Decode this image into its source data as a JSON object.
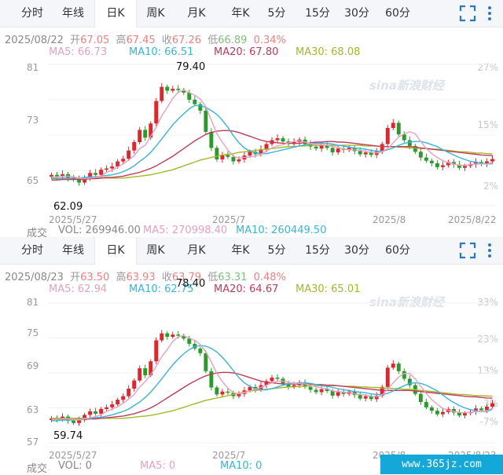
{
  "tabs": [
    "分时",
    "年线",
    "日K",
    "周K",
    "月K",
    "年K",
    "5分",
    "15分",
    "30分",
    "60分"
  ],
  "active_tab": "日K",
  "colors": {
    "up": "#e3242b",
    "down": "#2a9b2a",
    "ma5": "#e8a0bf",
    "ma10": "#35b5e0",
    "ma20": "#c43a5a",
    "ma30": "#a4b828"
  },
  "charts": [
    {
      "header": {
        "date": "2025/08/22",
        "open_label": "开",
        "open": "67.05",
        "high_label": "高",
        "high": "67.45",
        "close_label": "收",
        "close": "67.26",
        "low_label": "低",
        "low": "66.89",
        "change_pct": "0.34%"
      },
      "ma_labels": {
        "ma5": "MA5: 66.73",
        "ma10": "MA10: 66.51",
        "ma20": "MA20: 67.80",
        "ma30": "MA30: 68.08"
      },
      "y_ticks": [
        "81",
        "73",
        "65"
      ],
      "y_pct_ticks": [
        "27%",
        "15%",
        "2%"
      ],
      "x_ticks": [
        "2025/5/27",
        "2025/7",
        "2025/8",
        "2025/8/22"
      ],
      "annotations": {
        "max": "79.40",
        "min": "62.09"
      },
      "volume": {
        "label": "成交",
        "vol": "VOL: 269946.00",
        "ma5": "MA5: 270998.40",
        "ma10": "MA10: 260449.50"
      },
      "watermark": "sina新浪财经"
    },
    {
      "header": {
        "date": "2025/08/23",
        "open_label": "开",
        "open": "63.50",
        "high_label": "高",
        "high": "63.93",
        "close_label": "收",
        "close": "63.79",
        "low_label": "低",
        "low": "63.31",
        "change_pct": "0.48%"
      },
      "ma_labels": {
        "ma5": "MA5: 62.94",
        "ma10": "MA10: 62.75",
        "ma20": "MA20: 64.67",
        "ma30": "MA30: 65.01"
      },
      "y_ticks": [
        "81",
        "75",
        "69",
        "63",
        "57"
      ],
      "y_pct_ticks": [
        "33%",
        "23%",
        "13%",
        "3%",
        "-7%"
      ],
      "x_ticks": [
        "2025/5/27",
        "2025/7",
        "2025/8",
        "2025/8/23"
      ],
      "annotations": {
        "max": "78.40",
        "min": "59.74"
      },
      "volume": {
        "label": "成交",
        "vol": "VOL: 0",
        "ma5": "MA5: 0",
        "ma10": "MA10: 0"
      },
      "watermark": "sina新浪财经"
    }
  ],
  "chart_data": [
    {
      "type": "candlestick",
      "ylim": [
        60,
        82
      ],
      "close": [
        64.8,
        64.5,
        64.9,
        64.3,
        64.1,
        63.6,
        64.4,
        65.1,
        64.8,
        65.6,
        65.8,
        66.1,
        66.9,
        67.3,
        68.6,
        69.9,
        71.8,
        70.6,
        72.8,
        76.3,
        78.5,
        77.9,
        78.2,
        78.0,
        77.6,
        76.5,
        75.8,
        74.8,
        71.5,
        69.0,
        67.2,
        67.9,
        67.6,
        66.9,
        67.2,
        67.8,
        68.4,
        68.0,
        68.8,
        69.6,
        70.2,
        70.5,
        70.0,
        69.6,
        69.9,
        70.3,
        69.6,
        69.2,
        68.9,
        69.4,
        69.0,
        68.3,
        68.9,
        68.7,
        69.0,
        68.5,
        68.0,
        68.3,
        67.9,
        68.4,
        69.6,
        72.1,
        72.9,
        71.1,
        70.2,
        69.3,
        68.4,
        67.5,
        67.0,
        66.6,
        66.0,
        66.3,
        66.8,
        66.4,
        65.9,
        66.2,
        66.4,
        66.8,
        66.5,
        66.9,
        67.26
      ],
      "ma5": [
        64.5,
        64.5,
        64.6,
        64.6,
        64.5,
        64.3,
        64.2,
        64.3,
        64.4,
        64.6,
        65.2,
        65.5,
        66.0,
        66.5,
        67.1,
        67.8,
        68.9,
        69.4,
        70.8,
        72.2,
        74.0,
        75.3,
        76.7,
        77.7,
        78.0,
        77.6,
        77.2,
        76.6,
        75.4,
        73.3,
        71.2,
        69.9,
        68.7,
        67.7,
        67.4,
        67.5,
        67.6,
        67.7,
        68.0,
        68.5,
        69.0,
        69.3,
        69.5,
        69.8,
        70.0,
        70.1,
        69.9,
        69.7,
        69.5,
        69.5,
        69.4,
        69.2,
        69.1,
        68.8,
        68.7,
        68.7,
        68.6,
        68.5,
        68.3,
        68.2,
        68.4,
        68.9,
        69.8,
        70.7,
        71.2,
        71.5,
        71.2,
        70.0,
        68.9,
        68.1,
        67.5,
        67.0,
        66.7,
        66.5,
        66.3,
        66.3,
        66.4,
        66.5,
        66.5,
        66.5,
        66.73
      ],
      "ma10": [
        64.2,
        64.2,
        64.3,
        64.3,
        64.3,
        64.3,
        64.4,
        64.5,
        64.5,
        64.6,
        64.7,
        64.8,
        65.0,
        65.3,
        65.7,
        66.2,
        66.9,
        67.5,
        68.3,
        69.3,
        70.4,
        71.5,
        72.6,
        73.5,
        74.3,
        75.1,
        75.6,
        75.6,
        75.3,
        74.8,
        74.2,
        73.3,
        72.2,
        70.9,
        69.8,
        69.0,
        68.5,
        68.2,
        68.1,
        68.1,
        68.3,
        68.5,
        68.7,
        68.9,
        69.1,
        69.3,
        69.5,
        69.6,
        69.7,
        69.7,
        69.7,
        69.6,
        69.4,
        69.3,
        69.1,
        69.0,
        68.9,
        68.8,
        68.6,
        68.5,
        68.5,
        68.7,
        69.0,
        69.4,
        69.7,
        69.9,
        70.0,
        70.0,
        69.8,
        69.5,
        69.2,
        68.7,
        68.3,
        67.9,
        67.5,
        67.2,
        66.9,
        66.8,
        66.6,
        66.5,
        66.51
      ],
      "ma20": [
        64.0,
        64.0,
        64.1,
        64.1,
        64.1,
        64.1,
        64.1,
        64.2,
        64.2,
        64.3,
        64.4,
        64.4,
        64.5,
        64.6,
        64.8,
        65.0,
        65.2,
        65.5,
        65.8,
        66.2,
        66.7,
        67.2,
        67.7,
        68.3,
        68.9,
        69.5,
        70.1,
        70.6,
        71.1,
        71.4,
        71.6,
        71.7,
        71.7,
        71.6,
        71.4,
        71.1,
        70.8,
        70.5,
        70.2,
        70.0,
        69.9,
        69.8,
        69.7,
        69.7,
        69.7,
        69.7,
        69.8,
        69.8,
        69.9,
        69.9,
        70.0,
        70.0,
        69.9,
        69.9,
        69.8,
        69.7,
        69.6,
        69.5,
        69.4,
        69.3,
        69.2,
        69.2,
        69.2,
        69.2,
        69.2,
        69.2,
        69.1,
        69.0,
        68.9,
        68.8,
        68.7,
        68.6,
        68.5,
        68.4,
        68.3,
        68.2,
        68.1,
        68.0,
        67.9,
        67.85,
        67.8
      ],
      "ma30": [
        64.3,
        64.3,
        64.3,
        64.3,
        64.3,
        64.3,
        64.3,
        64.3,
        64.3,
        64.3,
        64.3,
        64.3,
        64.3,
        64.3,
        64.4,
        64.5,
        64.6,
        64.7,
        64.8,
        65.0,
        65.2,
        65.4,
        65.6,
        65.9,
        66.2,
        66.5,
        66.8,
        67.1,
        67.3,
        67.5,
        67.7,
        67.9,
        68.0,
        68.1,
        68.3,
        68.4,
        68.5,
        68.6,
        68.7,
        68.8,
        68.9,
        69.0,
        69.1,
        69.2,
        69.2,
        69.3,
        69.3,
        69.4,
        69.4,
        69.4,
        69.4,
        69.4,
        69.4,
        69.4,
        69.4,
        69.4,
        69.4,
        69.3,
        69.3,
        69.3,
        69.2,
        69.2,
        69.2,
        69.1,
        69.1,
        69.0,
        69.0,
        68.9,
        68.9,
        68.8,
        68.8,
        68.7,
        68.6,
        68.5,
        68.4,
        68.4,
        68.3,
        68.2,
        68.2,
        68.1,
        68.08
      ]
    },
    {
      "type": "candlestick",
      "ylim": [
        57,
        81
      ],
      "close": [
        61.2,
        61.0,
        61.5,
        60.8,
        60.4,
        60.9,
        61.8,
        62.4,
        62.0,
        62.8,
        63.1,
        63.6,
        64.4,
        65.0,
        66.3,
        67.7,
        69.8,
        68.6,
        71.0,
        74.6,
        75.8,
        75.2,
        75.6,
        75.4,
        74.9,
        74.0,
        73.2,
        72.4,
        69.3,
        66.5,
        65.3,
        65.8,
        65.6,
        65.0,
        65.4,
        66.0,
        66.6,
        66.1,
        66.9,
        67.6,
        68.2,
        68.0,
        67.2,
        66.6,
        66.9,
        67.4,
        66.6,
        66.1,
        65.7,
        66.2,
        65.9,
        65.1,
        65.7,
        65.4,
        65.8,
        65.2,
        64.6,
        65.0,
        64.5,
        65.1,
        66.6,
        69.9,
        70.6,
        69.3,
        68.0,
        66.9,
        65.4,
        64.0,
        63.1,
        62.5,
        61.9,
        62.3,
        62.8,
        62.2,
        61.7,
        62.1,
        62.3,
        62.9,
        62.6,
        63.2,
        63.79
      ],
      "ma5": [
        61.0,
        61.0,
        61.1,
        61.1,
        61.0,
        60.9,
        61.1,
        61.3,
        61.5,
        61.8,
        62.4,
        62.8,
        63.2,
        63.8,
        64.5,
        65.3,
        66.6,
        67.5,
        68.7,
        70.1,
        71.8,
        73.0,
        74.4,
        75.2,
        75.4,
        75.0,
        74.6,
        73.9,
        72.6,
        70.9,
        68.9,
        67.5,
        66.4,
        65.6,
        65.4,
        65.6,
        65.9,
        66.2,
        66.5,
        66.9,
        67.3,
        67.6,
        67.6,
        67.4,
        67.2,
        67.2,
        67.1,
        66.9,
        66.6,
        66.4,
        66.3,
        65.9,
        65.8,
        65.7,
        65.6,
        65.4,
        65.3,
        65.2,
        65.0,
        64.9,
        65.2,
        66.2,
        67.3,
        68.3,
        68.9,
        68.9,
        68.0,
        66.7,
        65.5,
        64.4,
        63.6,
        62.9,
        62.6,
        62.4,
        62.2,
        62.2,
        62.2,
        62.4,
        62.4,
        62.5,
        62.94
      ],
      "ma10": [
        60.8,
        60.8,
        60.9,
        60.9,
        60.9,
        61.0,
        61.1,
        61.2,
        61.3,
        61.4,
        61.6,
        61.8,
        62.1,
        62.4,
        62.8,
        63.4,
        64.0,
        64.8,
        65.7,
        66.8,
        68.0,
        69.2,
        70.4,
        71.4,
        72.3,
        73.0,
        73.5,
        73.7,
        73.6,
        73.2,
        72.6,
        71.7,
        70.6,
        69.4,
        68.2,
        67.3,
        66.7,
        66.3,
        66.1,
        66.1,
        66.3,
        66.6,
        66.9,
        67.1,
        67.2,
        67.3,
        67.3,
        67.2,
        67.0,
        66.8,
        66.7,
        66.5,
        66.3,
        66.1,
        66.0,
        65.8,
        65.7,
        65.6,
        65.4,
        65.3,
        65.3,
        65.5,
        65.9,
        66.4,
        66.8,
        67.2,
        67.3,
        67.2,
        66.9,
        66.4,
        65.9,
        65.2,
        64.5,
        63.9,
        63.4,
        63.0,
        62.7,
        62.5,
        62.4,
        62.4,
        62.75
      ],
      "ma20": [
        61.0,
        61.0,
        61.0,
        61.0,
        61.0,
        61.0,
        61.0,
        61.1,
        61.1,
        61.2,
        61.3,
        61.4,
        61.5,
        61.6,
        61.8,
        62.0,
        62.3,
        62.6,
        63.0,
        63.5,
        64.1,
        64.7,
        65.3,
        65.9,
        66.5,
        67.1,
        67.6,
        68.1,
        68.5,
        68.8,
        69.0,
        69.1,
        69.1,
        69.0,
        68.8,
        68.5,
        68.2,
        67.9,
        67.6,
        67.4,
        67.3,
        67.2,
        67.1,
        67.1,
        67.1,
        67.1,
        67.1,
        67.1,
        67.0,
        67.0,
        66.9,
        66.9,
        66.8,
        66.7,
        66.6,
        66.5,
        66.4,
        66.3,
        66.2,
        66.1,
        66.0,
        66.0,
        66.0,
        66.0,
        66.0,
        66.0,
        65.9,
        65.8,
        65.7,
        65.6,
        65.5,
        65.4,
        65.3,
        65.2,
        65.1,
        65.0,
        64.9,
        64.9,
        64.8,
        64.7,
        64.67
      ],
      "ma30": [
        61.2,
        61.2,
        61.2,
        61.2,
        61.2,
        61.2,
        61.2,
        61.2,
        61.2,
        61.2,
        61.2,
        61.2,
        61.2,
        61.2,
        61.3,
        61.4,
        61.5,
        61.6,
        61.7,
        61.9,
        62.1,
        62.3,
        62.5,
        62.8,
        63.1,
        63.4,
        63.7,
        64.0,
        64.3,
        64.5,
        64.7,
        64.9,
        65.1,
        65.3,
        65.5,
        65.7,
        65.9,
        66.0,
        66.1,
        66.2,
        66.3,
        66.4,
        66.5,
        66.6,
        66.6,
        66.7,
        66.7,
        66.8,
        66.8,
        66.8,
        66.8,
        66.8,
        66.8,
        66.7,
        66.7,
        66.7,
        66.6,
        66.6,
        66.5,
        66.5,
        66.4,
        66.4,
        66.3,
        66.3,
        66.2,
        66.2,
        66.1,
        66.0,
        65.9,
        65.8,
        65.7,
        65.6,
        65.5,
        65.4,
        65.3,
        65.3,
        65.2,
        65.1,
        65.1,
        65.05,
        65.01
      ]
    }
  ]
}
